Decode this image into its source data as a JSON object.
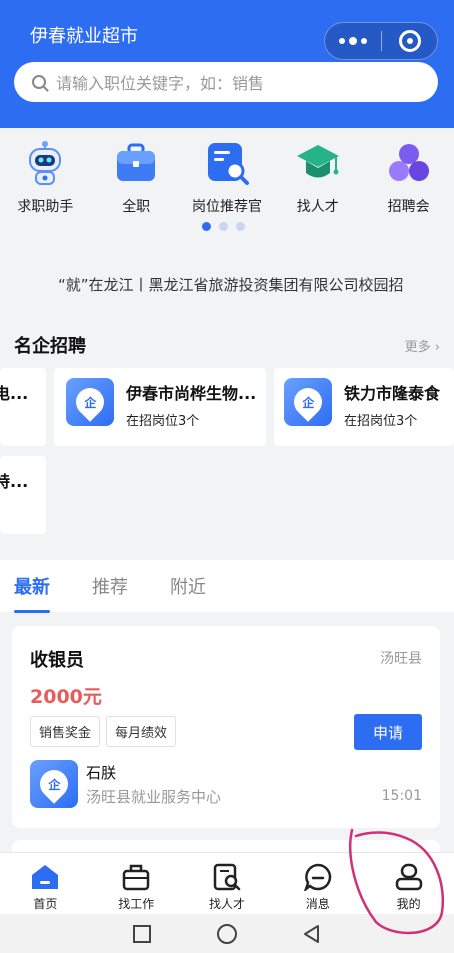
{
  "app": {
    "title": "伊春就业超市"
  },
  "search": {
    "placeholder": "请输入职位关键字，如：销售"
  },
  "menu": {
    "items": [
      {
        "label": "求职助手",
        "icon": "robot-icon"
      },
      {
        "label": "全职",
        "icon": "briefcase-icon"
      },
      {
        "label": "岗位推荐官",
        "icon": "document-search-icon"
      },
      {
        "label": "找人才",
        "icon": "graduation-cap-icon"
      },
      {
        "label": "招聘会",
        "icon": "people-icon"
      }
    ],
    "page_indicator": {
      "current": 1,
      "total": 3
    }
  },
  "ticker": {
    "text": "“就”在龙江丨黑龙江省旅游投资集团有限公司校园招"
  },
  "featured": {
    "title": "名企招聘",
    "more": "更多",
    "companies": [
      {
        "name": "电...",
        "count": ""
      },
      {
        "name": "伊春市尚桦生物...",
        "count": "在招岗位3个"
      },
      {
        "name": "铁力市隆泰食",
        "count": "在招岗位3个"
      },
      {
        "name": "特...",
        "count": ""
      }
    ],
    "logo_char": "企"
  },
  "tabs": [
    {
      "label": "最新",
      "active": true
    },
    {
      "label": "推荐",
      "active": false
    },
    {
      "label": "附近",
      "active": false
    }
  ],
  "job": {
    "title": "收银员",
    "location": "汤旺县",
    "salary": "2000元",
    "tags": [
      "销售奖金",
      "每月绩效"
    ],
    "apply_label": "申请",
    "logo_char": "企",
    "contact": "石朕",
    "org": "汤旺县就业服务中心",
    "time": "15:01"
  },
  "tabbar": {
    "items": [
      {
        "label": "首页",
        "icon": "home-icon",
        "active": true
      },
      {
        "label": "找工作",
        "icon": "briefcase-outline-icon",
        "active": false
      },
      {
        "label": "找人才",
        "icon": "resume-search-icon",
        "active": false
      },
      {
        "label": "消息",
        "icon": "message-icon",
        "active": false
      },
      {
        "label": "我的",
        "icon": "user-icon",
        "active": false
      }
    ]
  },
  "colors": {
    "primary": "#2d6df2",
    "salary": "#e85c5c",
    "annotation": "#d0307a"
  }
}
